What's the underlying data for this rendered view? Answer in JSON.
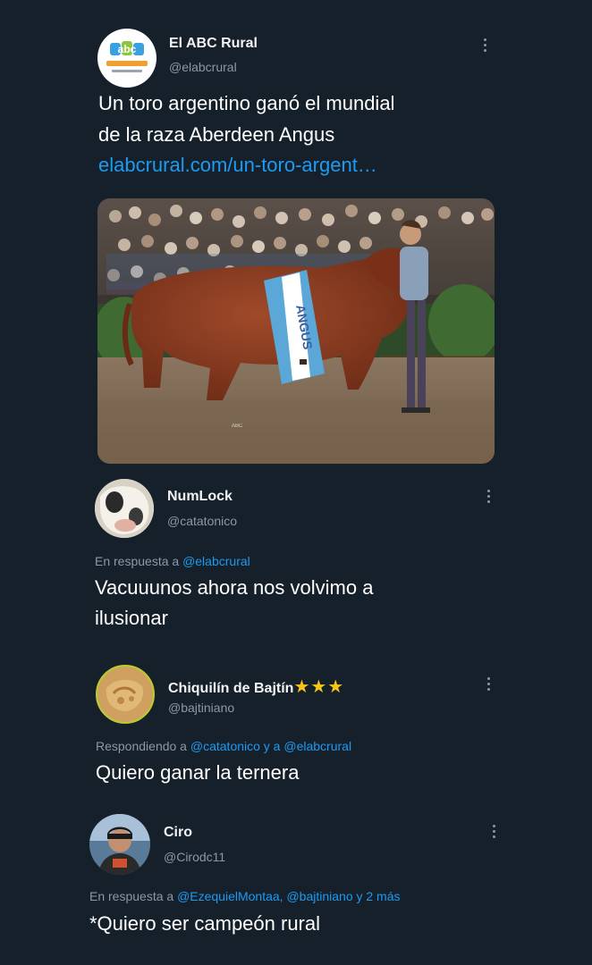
{
  "tweet": {
    "author_name": "El ABC Rural",
    "author_handle": "@elabcrural",
    "avatar_logo_text": "abc",
    "text_line1": "Un toro argentino ganó el mundial",
    "text_line2": "de la raza Aberdeen Angus",
    "link": "elabcrural.com/un-toro-argent…",
    "image_icon": "bull-photo"
  },
  "replies": [
    {
      "author_name": "NumLock",
      "author_handle": "@catatonico",
      "reply_prefix": "En respuesta a",
      "reply_mentions": "@elabcrural",
      "text_line1": "Vacuuunos ahora nos volvimo a",
      "text_line2": "ilusionar"
    },
    {
      "author_name": "Chiquilín de Bajtín",
      "author_stars": "★★★",
      "author_handle": "@bajtiniano",
      "reply_prefix": "Respondiendo a",
      "reply_mentions": "@catatonico y a @elabcrural",
      "text_line1": "Quiero ganar la ternera"
    },
    {
      "author_name": "Ciro",
      "author_handle": "@Cirodc11",
      "reply_prefix": "En respuesta a",
      "reply_mentions": "@EzequielMontaa, @bajtiniano y 2 más",
      "text_line1": "*Quiero ser campeón rural"
    }
  ],
  "colors": {
    "background": "#15202b",
    "link": "#1d9bf0",
    "muted": "#8b98a5",
    "star": "#f5c518"
  }
}
